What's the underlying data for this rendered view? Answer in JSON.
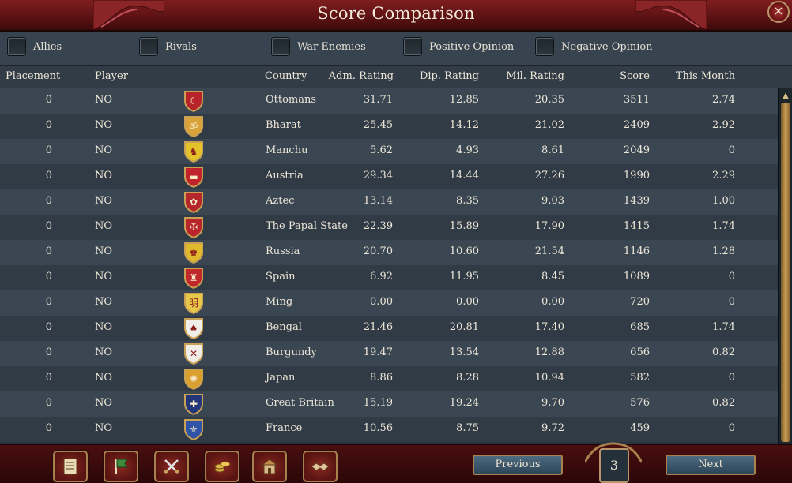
{
  "window": {
    "title": "Score Comparison",
    "close_label": "×"
  },
  "filters": [
    {
      "label": "Allies"
    },
    {
      "label": "Rivals"
    },
    {
      "label": "War Enemies"
    },
    {
      "label": "Positive Opinion"
    },
    {
      "label": "Negative Opinion"
    }
  ],
  "columns": {
    "placement": "Placement",
    "player": "Player",
    "country": "Country",
    "adm": "Adm. Rating",
    "dip": "Dip. Rating",
    "mil": "Mil. Rating",
    "score": "Score",
    "month": "This Month"
  },
  "rows": [
    {
      "placement": "0",
      "player": "NO",
      "country": "Ottomans",
      "adm": "31.71",
      "dip": "12.85",
      "mil": "20.35",
      "score": "3511",
      "month": "2.74",
      "flag_color": "#b8232a",
      "flag_symbol": "☾"
    },
    {
      "placement": "0",
      "player": "NO",
      "country": "Bharat",
      "adm": "25.45",
      "dip": "14.12",
      "mil": "21.02",
      "score": "2409",
      "month": "2.92",
      "flag_color": "#d9a23a",
      "flag_symbol": "ॐ"
    },
    {
      "placement": "0",
      "player": "NO",
      "country": "Manchu",
      "adm": "5.62",
      "dip": "4.93",
      "mil": "8.61",
      "score": "2049",
      "month": "0",
      "flag_color": "#e4c32a",
      "flag_symbol": "♞"
    },
    {
      "placement": "0",
      "player": "NO",
      "country": "Austria",
      "adm": "29.34",
      "dip": "14.44",
      "mil": "27.26",
      "score": "1990",
      "month": "2.29",
      "flag_color": "#c0232b",
      "flag_symbol": "▬"
    },
    {
      "placement": "0",
      "player": "NO",
      "country": "Aztec",
      "adm": "13.14",
      "dip": "8.35",
      "mil": "9.03",
      "score": "1439",
      "month": "1.00",
      "flag_color": "#b5262a",
      "flag_symbol": "✿"
    },
    {
      "placement": "0",
      "player": "NO",
      "country": "The Papal State",
      "adm": "22.39",
      "dip": "15.89",
      "mil": "17.90",
      "score": "1415",
      "month": "1.74",
      "flag_color": "#b8252b",
      "flag_symbol": "✠"
    },
    {
      "placement": "0",
      "player": "NO",
      "country": "Russia",
      "adm": "20.70",
      "dip": "10.60",
      "mil": "21.54",
      "score": "1146",
      "month": "1.28",
      "flag_color": "#e0b92c",
      "flag_symbol": "♚"
    },
    {
      "placement": "0",
      "player": "NO",
      "country": "Spain",
      "adm": "6.92",
      "dip": "11.95",
      "mil": "8.45",
      "score": "1089",
      "month": "0",
      "flag_color": "#c0282c",
      "flag_symbol": "♜"
    },
    {
      "placement": "0",
      "player": "NO",
      "country": "Ming",
      "adm": "0.00",
      "dip": "0.00",
      "mil": "0.00",
      "score": "720",
      "month": "0",
      "flag_color": "#e6c94a",
      "flag_symbol": "明"
    },
    {
      "placement": "0",
      "player": "NO",
      "country": "Bengal",
      "adm": "21.46",
      "dip": "20.81",
      "mil": "17.40",
      "score": "685",
      "month": "1.74",
      "flag_color": "#f0eee8",
      "flag_symbol": "♠"
    },
    {
      "placement": "0",
      "player": "NO",
      "country": "Burgundy",
      "adm": "19.47",
      "dip": "13.54",
      "mil": "12.88",
      "score": "656",
      "month": "0.82",
      "flag_color": "#f0ede6",
      "flag_symbol": "✕"
    },
    {
      "placement": "0",
      "player": "NO",
      "country": "Japan",
      "adm": "8.86",
      "dip": "8.28",
      "mil": "10.94",
      "score": "582",
      "month": "0",
      "flag_color": "#d9a030",
      "flag_symbol": "✺"
    },
    {
      "placement": "0",
      "player": "NO",
      "country": "Great Britain",
      "adm": "15.19",
      "dip": "19.24",
      "mil": "9.70",
      "score": "576",
      "month": "0.82",
      "flag_color": "#23367a",
      "flag_symbol": "✚"
    },
    {
      "placement": "0",
      "player": "NO",
      "country": "France",
      "adm": "10.56",
      "dip": "8.75",
      "mil": "9.72",
      "score": "459",
      "month": "0",
      "flag_color": "#2f53a6",
      "flag_symbol": "⚜"
    }
  ],
  "bottom": {
    "icon_buttons": [
      {
        "icon": "ledger-icon"
      },
      {
        "icon": "flag-icon"
      },
      {
        "icon": "crossed-swords-icon"
      },
      {
        "icon": "coins-icon"
      },
      {
        "icon": "building-icon"
      },
      {
        "icon": "handshake-icon"
      }
    ],
    "previous_label": "Previous",
    "page_number": "3",
    "next_label": "Next"
  },
  "colors": {
    "accent_red": "#5e1214",
    "gold_trim": "#b8946a",
    "row_odd": "#3a4651",
    "row_even": "#313b45"
  }
}
